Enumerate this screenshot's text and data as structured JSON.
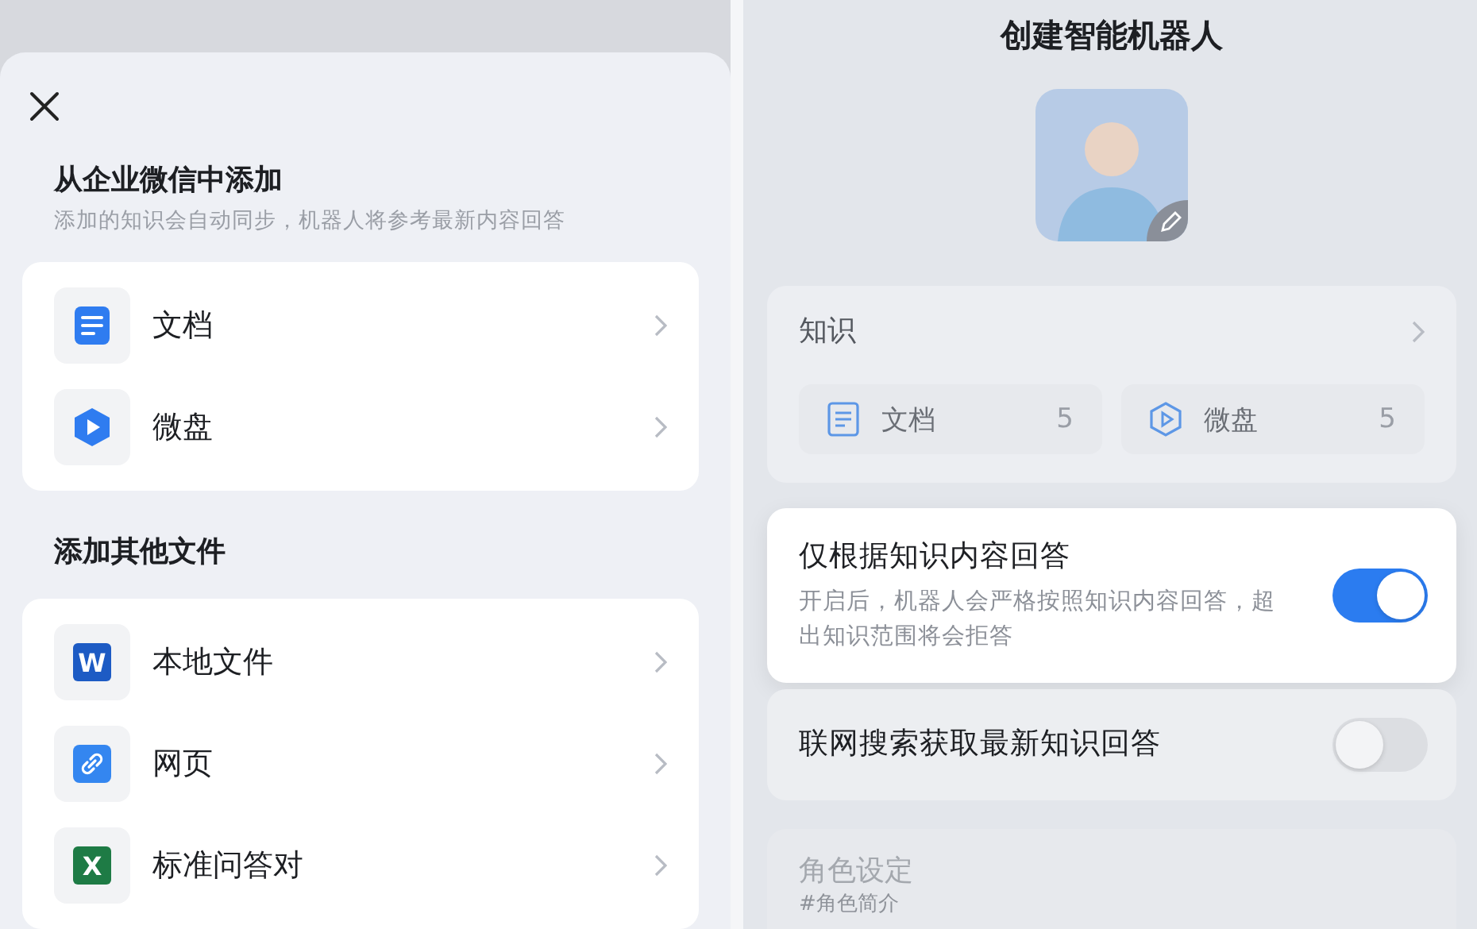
{
  "left_sheet": {
    "sections": [
      {
        "title": "从企业微信中添加",
        "subtitle": "添加的知识会自动同步，机器人将参考最新内容回答",
        "items": [
          {
            "label": "文档",
            "kind": "doc"
          },
          {
            "label": "微盘",
            "kind": "drive"
          }
        ]
      },
      {
        "title": "添加其他文件",
        "items": [
          {
            "label": "本地文件",
            "kind": "word",
            "badge": "W"
          },
          {
            "label": "网页",
            "kind": "link"
          },
          {
            "label": "标准问答对",
            "kind": "excel",
            "badge": "X"
          }
        ]
      }
    ]
  },
  "right_page": {
    "title": "创建智能机器人",
    "knowledge": {
      "label": "知识",
      "sources": [
        {
          "label": "文档",
          "count": "5",
          "kind": "doc"
        },
        {
          "label": "微盘",
          "count": "5",
          "kind": "drive"
        }
      ]
    },
    "settings": [
      {
        "title": "仅根据知识内容回答",
        "description": "开启后，机器人会严格按照知识内容回答，超出知识范围将会拒答",
        "on": true,
        "highlighted": true
      },
      {
        "title": "联网搜索获取最新知识回答",
        "on": false,
        "highlighted": false
      }
    ],
    "role": {
      "label": "角色设定",
      "placeholder": "#角色简介"
    }
  }
}
